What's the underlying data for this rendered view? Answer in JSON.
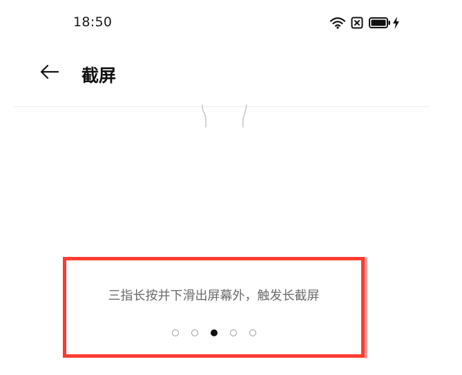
{
  "status_bar": {
    "time": "18:50",
    "icons": [
      "wifi-icon",
      "sim-disabled-icon",
      "battery-full-icon",
      "charging-bolt-icon"
    ]
  },
  "header": {
    "back_icon": "arrow-left-icon",
    "title": "截屏"
  },
  "tutorial": {
    "instruction": "三指长按并下滑出屏幕外，触发长截屏",
    "pager": {
      "total": 5,
      "active_index": 2
    }
  },
  "colors": {
    "highlight_border": "#ff3b30",
    "text_secondary": "#6a6a6a",
    "dot_active": "#111111"
  }
}
